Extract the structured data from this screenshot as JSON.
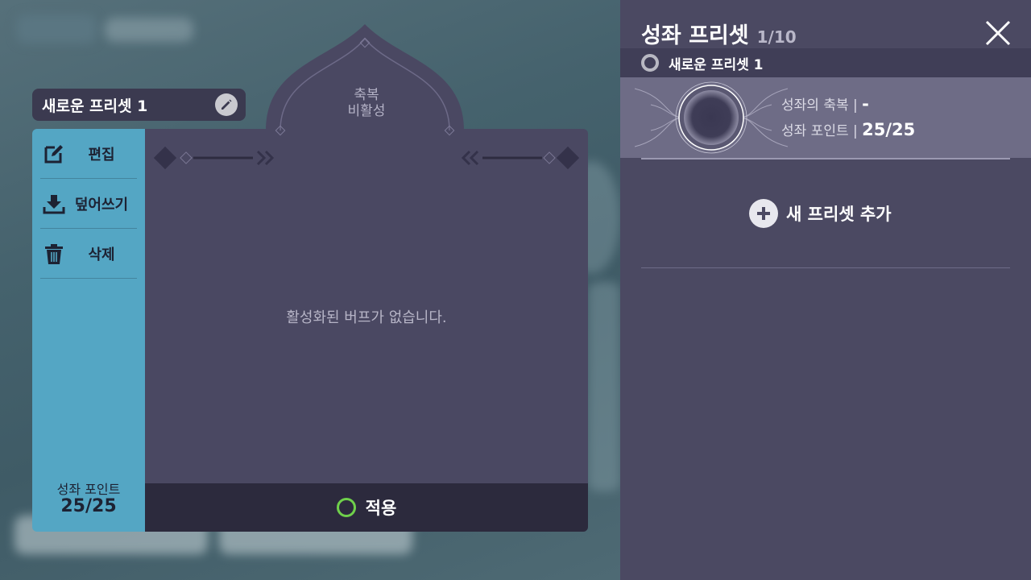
{
  "preset_editor": {
    "preset_name": "새로운 프리셋 1",
    "actions": [
      {
        "label": "편집",
        "icon": "edit-icon"
      },
      {
        "label": "덮어쓰기",
        "icon": "download-icon"
      },
      {
        "label": "삭제",
        "icon": "trash-icon"
      }
    ],
    "points_label": "성좌 포인트",
    "points_value": "25/25",
    "blessing_title_line1": "축복",
    "blessing_title_line2": "비활성",
    "empty_message": "활성화된 버프가 없습니다.",
    "apply_label": "적용"
  },
  "preset_list": {
    "title": "성좌 프리셋",
    "count": "1/10",
    "selected_name": "새로운 프리셋 1",
    "card": {
      "blessing_label": "성좌의 축복",
      "blessing_value": "-",
      "points_label": "성좌 포인트",
      "points_value": "25/25"
    },
    "add_label": "새 프리셋 추가"
  },
  "colors": {
    "side_panel": "#54a6c4",
    "main_panel": "#4a4862",
    "apply_ring": "#6fd04b"
  }
}
